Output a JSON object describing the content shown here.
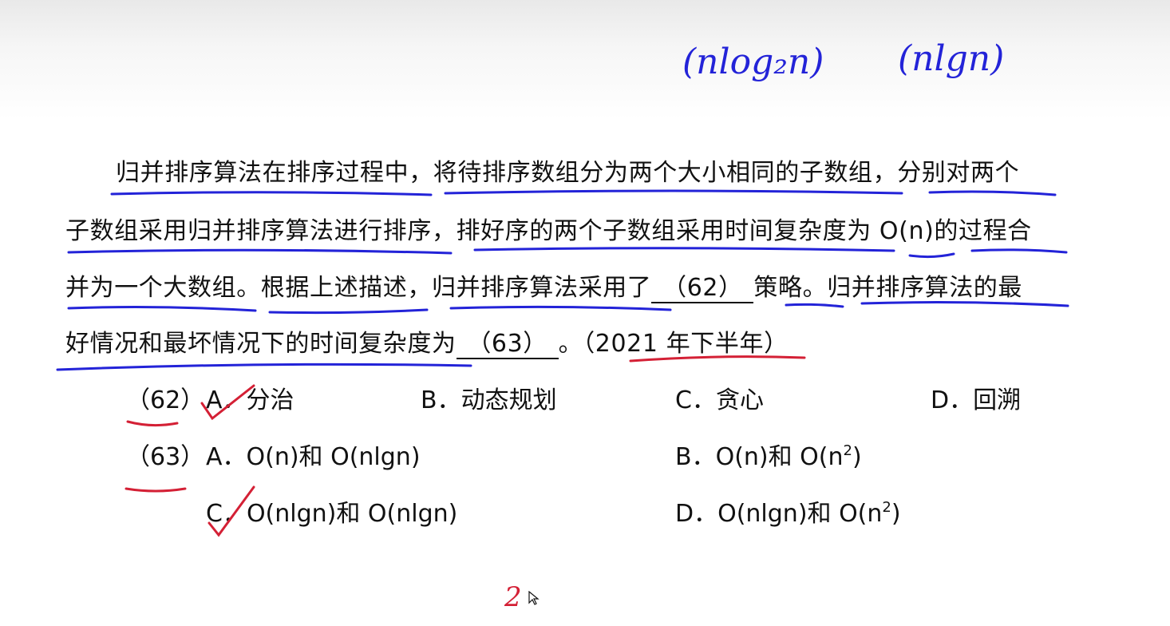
{
  "annotations": {
    "hand_left": "(nlog₂n)",
    "hand_right": "(nlgn)",
    "page_mark": "2"
  },
  "question": {
    "line1": "归并排序算法在排序过程中，将待排序数组分为两个大小相同的子数组，分别对两个",
    "line2": "子数组采用归并排序算法进行排序，排好序的两个子数组采用时间复杂度为 O(n)的过程合",
    "line3_a": "并为一个大数组。根据上述描述，归并排序算法采用了",
    "blank62": "（62）",
    "line3_b": "策略。归并排序算法的最",
    "line4_a": "好情况和最坏情况下的时间复杂度为",
    "blank63": "（63）",
    "line4_b": "。（2021 年下半年）"
  },
  "q62": {
    "num": "（62）",
    "A": "A．分治",
    "B": "B．动态规划",
    "C": "C．贪心",
    "D": "D．回溯"
  },
  "q63": {
    "num": "（63）",
    "A": "A．O(n)和 O(nlgn)",
    "B_pre": "B．O(n)和 O(n",
    "B_sup": "2",
    "B_post": ")",
    "C": "C．O(nlgn)和 O(nlgn)",
    "D_pre": "D．O(nlgn)和 O(n",
    "D_sup": "2",
    "D_post": ")"
  },
  "colors": {
    "ink_blue": "#2323d8",
    "ink_red": "#d42035",
    "text": "#111111"
  }
}
